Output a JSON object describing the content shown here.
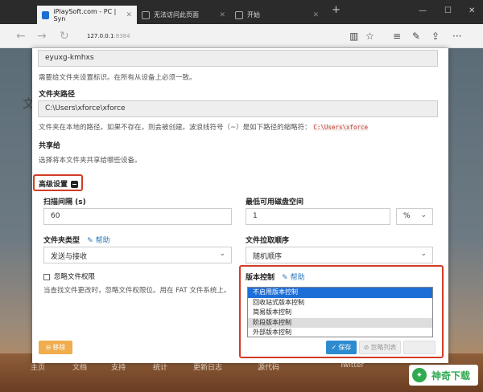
{
  "browser": {
    "tabs": [
      {
        "title": "iPlaySoft.com - PC | Syn"
      },
      {
        "title": "无法访问此页面"
      },
      {
        "title": "开始"
      }
    ],
    "url": "127.0.0.1",
    "url_port": ":8384"
  },
  "background": {
    "left_text": "文",
    "footer_items": [
      "主页",
      "文档",
      "支持",
      "统计",
      "更新日志",
      "源代码",
      "Twitter"
    ],
    "brand": "神奇下载"
  },
  "modal": {
    "device_id_value": "eyuxg-kmhxs",
    "device_id_help": "需要给文件夹设置标识。在所有从设备上必须一致。",
    "folder_path_label": "文件夹路径",
    "folder_path_value": "C:\\Users\\xforce\\xforce",
    "folder_path_help": "文件夹在本地的路径。如果不存在，则会被创建。波浪线符号（~）是如下路径的缩略符：",
    "folder_path_code": "C:\\Users\\xforce",
    "share_label": "共享给",
    "share_help": "选择将本文件夹共享给哪些设备。",
    "advanced_label": "高级设置",
    "scan_interval_label": "扫描间隔 (s)",
    "scan_interval_value": "60",
    "min_disk_label": "最低可用磁盘空间",
    "min_disk_value": "1",
    "min_disk_unit": "%",
    "folder_type_label": "文件夹类型",
    "folder_type_help": "帮助",
    "folder_type_value": "发送与接收",
    "pull_order_label": "文件拉取顺序",
    "pull_order_value": "随机顺序",
    "ignore_perms_label": "忽略文件权限",
    "ignore_perms_help": "当查找文件更改时，忽略文件权限位。用在 FAT 文件系统上。",
    "versioning_label": "版本控制",
    "versioning_help": "帮助",
    "versioning_options": [
      "不启用版本控制",
      "回收站式版本控制",
      "简易版本控制",
      "阶段版本控制",
      "外部版本控制"
    ],
    "remove_button": "移除",
    "save_button": "保存",
    "ignore_button": "忽略列表"
  }
}
